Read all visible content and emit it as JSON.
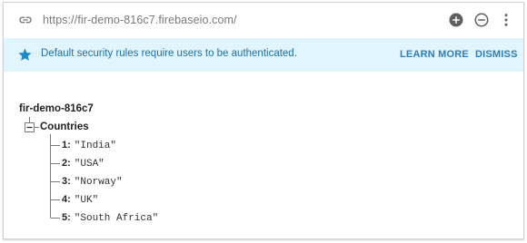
{
  "url_bar": {
    "url": "https://fir-demo-816c7.firebaseio.com/",
    "link_icon": "link-icon",
    "tools": [
      "add-circle-icon",
      "remove-circle-icon",
      "more-vert-icon"
    ]
  },
  "banner": {
    "text": "Default security rules require users to be authenticated.",
    "learn_more": "LEARN MORE",
    "dismiss": "DISMISS",
    "icon": "star-icon",
    "colors": {
      "background": "#e1f5fe",
      "text": "#1e6fa8",
      "accent": "#2a7fc1"
    }
  },
  "tree": {
    "root": "fir-demo-816c7",
    "node": "Countries",
    "toggle_glyph": "−",
    "children": [
      {
        "key": "1:",
        "value": "\"India\""
      },
      {
        "key": "2:",
        "value": "\"USA\""
      },
      {
        "key": "3:",
        "value": "\"Norway\""
      },
      {
        "key": "4:",
        "value": "\"UK\""
      },
      {
        "key": "5:",
        "value": "\"South Africa\""
      }
    ]
  }
}
